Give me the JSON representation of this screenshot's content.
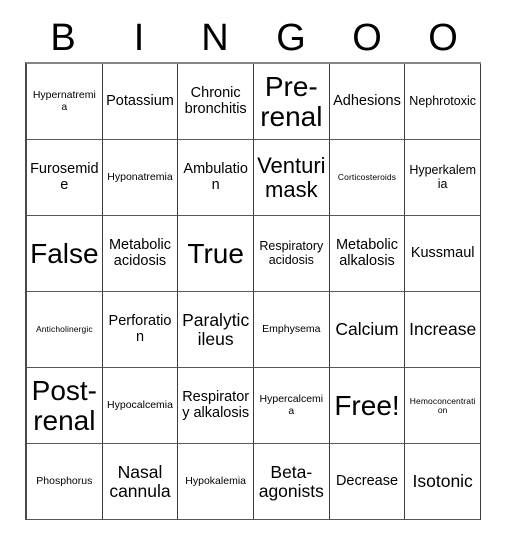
{
  "card": {
    "header_letters": [
      "B",
      "I",
      "N",
      "G",
      "O",
      "O"
    ],
    "rows": [
      [
        {
          "label": "Hypernatremia",
          "size": "xs"
        },
        {
          "label": "Potassium",
          "size": "m"
        },
        {
          "label": "Chronic bronchitis",
          "size": "m"
        },
        {
          "label": "Pre-renal",
          "size": "xxl"
        },
        {
          "label": "Adhesions",
          "size": "m"
        },
        {
          "label": "Nephrotoxic",
          "size": "s"
        }
      ],
      [
        {
          "label": "Furosemide",
          "size": "m"
        },
        {
          "label": "Hyponatremia",
          "size": "xs"
        },
        {
          "label": "Ambulation",
          "size": "m"
        },
        {
          "label": "Venturi mask",
          "size": "xl"
        },
        {
          "label": "Corticosteroids",
          "size": "xxs"
        },
        {
          "label": "Hyperkalemia",
          "size": "s"
        }
      ],
      [
        {
          "label": "False",
          "size": "xxl"
        },
        {
          "label": "Metabolic acidosis",
          "size": "m"
        },
        {
          "label": "True",
          "size": "xxl"
        },
        {
          "label": "Respiratory acidosis",
          "size": "s"
        },
        {
          "label": "Metabolic alkalosis",
          "size": "m"
        },
        {
          "label": "Kussmaul",
          "size": "m"
        }
      ],
      [
        {
          "label": "Anticholinergic",
          "size": "xxs"
        },
        {
          "label": "Perforation",
          "size": "m"
        },
        {
          "label": "Paralytic ileus",
          "size": "l"
        },
        {
          "label": "Emphysema",
          "size": "xs"
        },
        {
          "label": "Calcium",
          "size": "l"
        },
        {
          "label": "Increase",
          "size": "l"
        }
      ],
      [
        {
          "label": "Post-renal",
          "size": "xxl"
        },
        {
          "label": "Hypocalcemia",
          "size": "xs"
        },
        {
          "label": "Respiratory alkalosis",
          "size": "m"
        },
        {
          "label": "Hypercalcemia",
          "size": "xs"
        },
        {
          "label": "Free!",
          "size": "xxl"
        },
        {
          "label": "Hemoconcentration",
          "size": "xxs"
        }
      ],
      [
        {
          "label": "Phosphorus",
          "size": "xs"
        },
        {
          "label": "Nasal cannula",
          "size": "l"
        },
        {
          "label": "Hypokalemia",
          "size": "xs"
        },
        {
          "label": "Beta-agonists",
          "size": "l"
        },
        {
          "label": "Decrease",
          "size": "m"
        },
        {
          "label": "Isotonic",
          "size": "l"
        }
      ]
    ],
    "colors": {
      "background": "#ffffff",
      "text": "#000000",
      "grid_line": "#3c3c3c"
    }
  }
}
